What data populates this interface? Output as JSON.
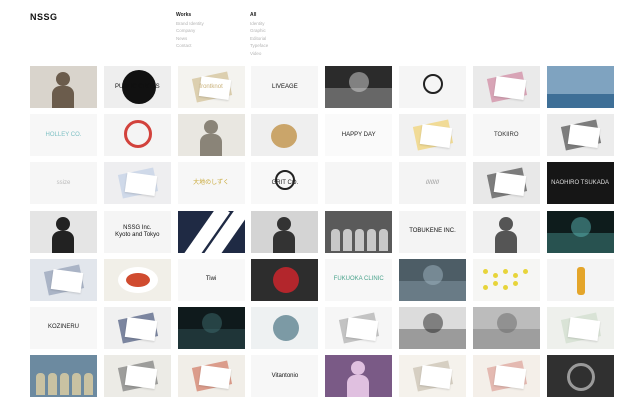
{
  "site": {
    "logo": "NSSG"
  },
  "nav": {
    "col1": {
      "heading": "Works",
      "items": [
        "Brand Identity",
        "Company",
        "News",
        "Contact"
      ]
    },
    "col2": {
      "heading": "All",
      "items": [
        "Identity",
        "Graphic",
        "Editorial",
        "Typeface",
        "Video"
      ]
    }
  },
  "tiles": [
    {
      "bg": "#d9d4cc",
      "fg": "#6b5c4c",
      "kind": "person",
      "text": ""
    },
    {
      "bg": "#eeeeee",
      "fg": "#111111",
      "kind": "jar",
      "text": "PUBLIC CROSS"
    },
    {
      "bg": "#f4f3ef",
      "fg": "#c9b17a",
      "kind": "card",
      "text": "frontknot"
    },
    {
      "bg": "#f6f6f6",
      "fg": "#111111",
      "kind": "text",
      "text": "LIVEAGE"
    },
    {
      "bg": "#2b2b2b",
      "fg": "#d8d8d8",
      "kind": "photo",
      "text": ""
    },
    {
      "bg": "#f5f5f5",
      "fg": "#222222",
      "kind": "logo",
      "text": ""
    },
    {
      "bg": "#eaeaea",
      "fg": "#c96a8a",
      "kind": "card",
      "text": ""
    },
    {
      "bg": "#7fa3c0",
      "fg": "#3e6f97",
      "kind": "sea",
      "text": ""
    },
    {
      "bg": "#f7f7f7",
      "fg": "#7dc0c4",
      "kind": "text",
      "text": "HOLLEY CO."
    },
    {
      "bg": "#f4f4f4",
      "fg": "#d2423c",
      "kind": "circle",
      "text": ""
    },
    {
      "bg": "#e9e7e1",
      "fg": "#8a8478",
      "kind": "person",
      "text": ""
    },
    {
      "bg": "#efefef",
      "fg": "#caa56a",
      "kind": "bear",
      "text": ""
    },
    {
      "bg": "#fafafa",
      "fg": "#222222",
      "kind": "text",
      "text": "HAPPY DAY"
    },
    {
      "bg": "#f1f1f1",
      "fg": "#f1c84a",
      "kind": "card",
      "text": ""
    },
    {
      "bg": "#f7f7f7",
      "fg": "#333333",
      "kind": "text",
      "text": "TOKIIRO"
    },
    {
      "bg": "#ececec",
      "fg": "#222222",
      "kind": "card",
      "text": ""
    },
    {
      "bg": "#f6f6f6",
      "fg": "#bbbbbb",
      "kind": "text",
      "text": "ssize"
    },
    {
      "bg": "#eeeef0",
      "fg": "#b7c9e4",
      "kind": "card",
      "text": ""
    },
    {
      "bg": "#f7f7f7",
      "fg": "#c9a93a",
      "kind": "text",
      "text": "大地のしずく"
    },
    {
      "bg": "#f8f8f8",
      "fg": "#222222",
      "kind": "logo",
      "text": "GRIT CO."
    },
    {
      "bg": "#f6f6f6",
      "fg": "#cccccc",
      "kind": "text",
      "text": ""
    },
    {
      "bg": "#f4f4f4",
      "fg": "#888888",
      "kind": "text",
      "text": "////////"
    },
    {
      "bg": "#e8e8e8",
      "fg": "#222222",
      "kind": "card",
      "text": ""
    },
    {
      "bg": "#161616",
      "fg": "#dddddd",
      "kind": "text",
      "text": "NAOHIRO TSUKADA"
    },
    {
      "bg": "#e5e5e5",
      "fg": "#222222",
      "kind": "person",
      "text": ""
    },
    {
      "bg": "#f5f5f5",
      "fg": "#111111",
      "kind": "text",
      "text": "NSSG Inc.\nKyoto and Tokyo"
    },
    {
      "bg": "#1f2a44",
      "fg": "#ffffff",
      "kind": "diag",
      "text": ""
    },
    {
      "bg": "#d4d4d4",
      "fg": "#333333",
      "kind": "person",
      "text": ""
    },
    {
      "bg": "#5a5a5a",
      "fg": "#c8c8c8",
      "kind": "crowd",
      "text": ""
    },
    {
      "bg": "#f4f4f4",
      "fg": "#111111",
      "kind": "text",
      "text": "TOBUKENE INC."
    },
    {
      "bg": "#f0f0f0",
      "fg": "#555555",
      "kind": "person",
      "text": ""
    },
    {
      "bg": "#0e1c1c",
      "fg": "#5ab6b3",
      "kind": "photo",
      "text": ""
    },
    {
      "bg": "#e2e6ec",
      "fg": "#7c8aa8",
      "kind": "card",
      "text": ""
    },
    {
      "bg": "#f1efe8",
      "fg": "#d04b2f",
      "kind": "food",
      "text": ""
    },
    {
      "bg": "#f8f8f8",
      "fg": "#111111",
      "kind": "text",
      "text": "Tiwi"
    },
    {
      "bg": "#2d2d2d",
      "fg": "#b3262c",
      "kind": "disc",
      "text": ""
    },
    {
      "bg": "#f7f7f7",
      "fg": "#4aa38c",
      "kind": "text",
      "text": "FUKUOKA CLINIC"
    },
    {
      "bg": "#4d5d66",
      "fg": "#9fb5c2",
      "kind": "photo",
      "text": ""
    },
    {
      "bg": "#f6f6f4",
      "fg": "#e7d43a",
      "kind": "dots",
      "text": ""
    },
    {
      "bg": "#f4f4f4",
      "fg": "#e4a52a",
      "kind": "bottle",
      "text": ""
    },
    {
      "bg": "#f7f7f7",
      "fg": "#222222",
      "kind": "text",
      "text": "KOZINERU"
    },
    {
      "bg": "#f0f0f0",
      "fg": "#1b2d5c",
      "kind": "card",
      "text": ""
    },
    {
      "bg": "#0f1a1c",
      "fg": "#3e6b6e",
      "kind": "photo",
      "text": ""
    },
    {
      "bg": "#eef1f2",
      "fg": "#7c9aa5",
      "kind": "disc",
      "text": ""
    },
    {
      "bg": "#f6f6f6",
      "fg": "#999999",
      "kind": "card",
      "text": ""
    },
    {
      "bg": "#dcdcdc",
      "fg": "#222222",
      "kind": "photo",
      "text": ""
    },
    {
      "bg": "#bcbcbc",
      "fg": "#666666",
      "kind": "photo",
      "text": ""
    },
    {
      "bg": "#eef0ec",
      "fg": "#c9d8c5",
      "kind": "card",
      "text": ""
    },
    {
      "bg": "#6c8aa0",
      "fg": "#c9c2a2",
      "kind": "crowd",
      "text": ""
    },
    {
      "bg": "#ecebe6",
      "fg": "#5c5c5c",
      "kind": "card",
      "text": ""
    },
    {
      "bg": "#f1eee8",
      "fg": "#c95a3e",
      "kind": "card",
      "text": ""
    },
    {
      "bg": "#f7f7f7",
      "fg": "#111111",
      "kind": "text",
      "text": "Vitantonio"
    },
    {
      "bg": "#7a5a86",
      "fg": "#e0c0e0",
      "kind": "person",
      "text": ""
    },
    {
      "bg": "#f5f2ec",
      "fg": "#bcb2a0",
      "kind": "card",
      "text": ""
    },
    {
      "bg": "#f4efe9",
      "fg": "#d78d84",
      "kind": "card",
      "text": ""
    },
    {
      "bg": "#303030",
      "fg": "#9a9a9a",
      "kind": "camera",
      "text": ""
    }
  ]
}
